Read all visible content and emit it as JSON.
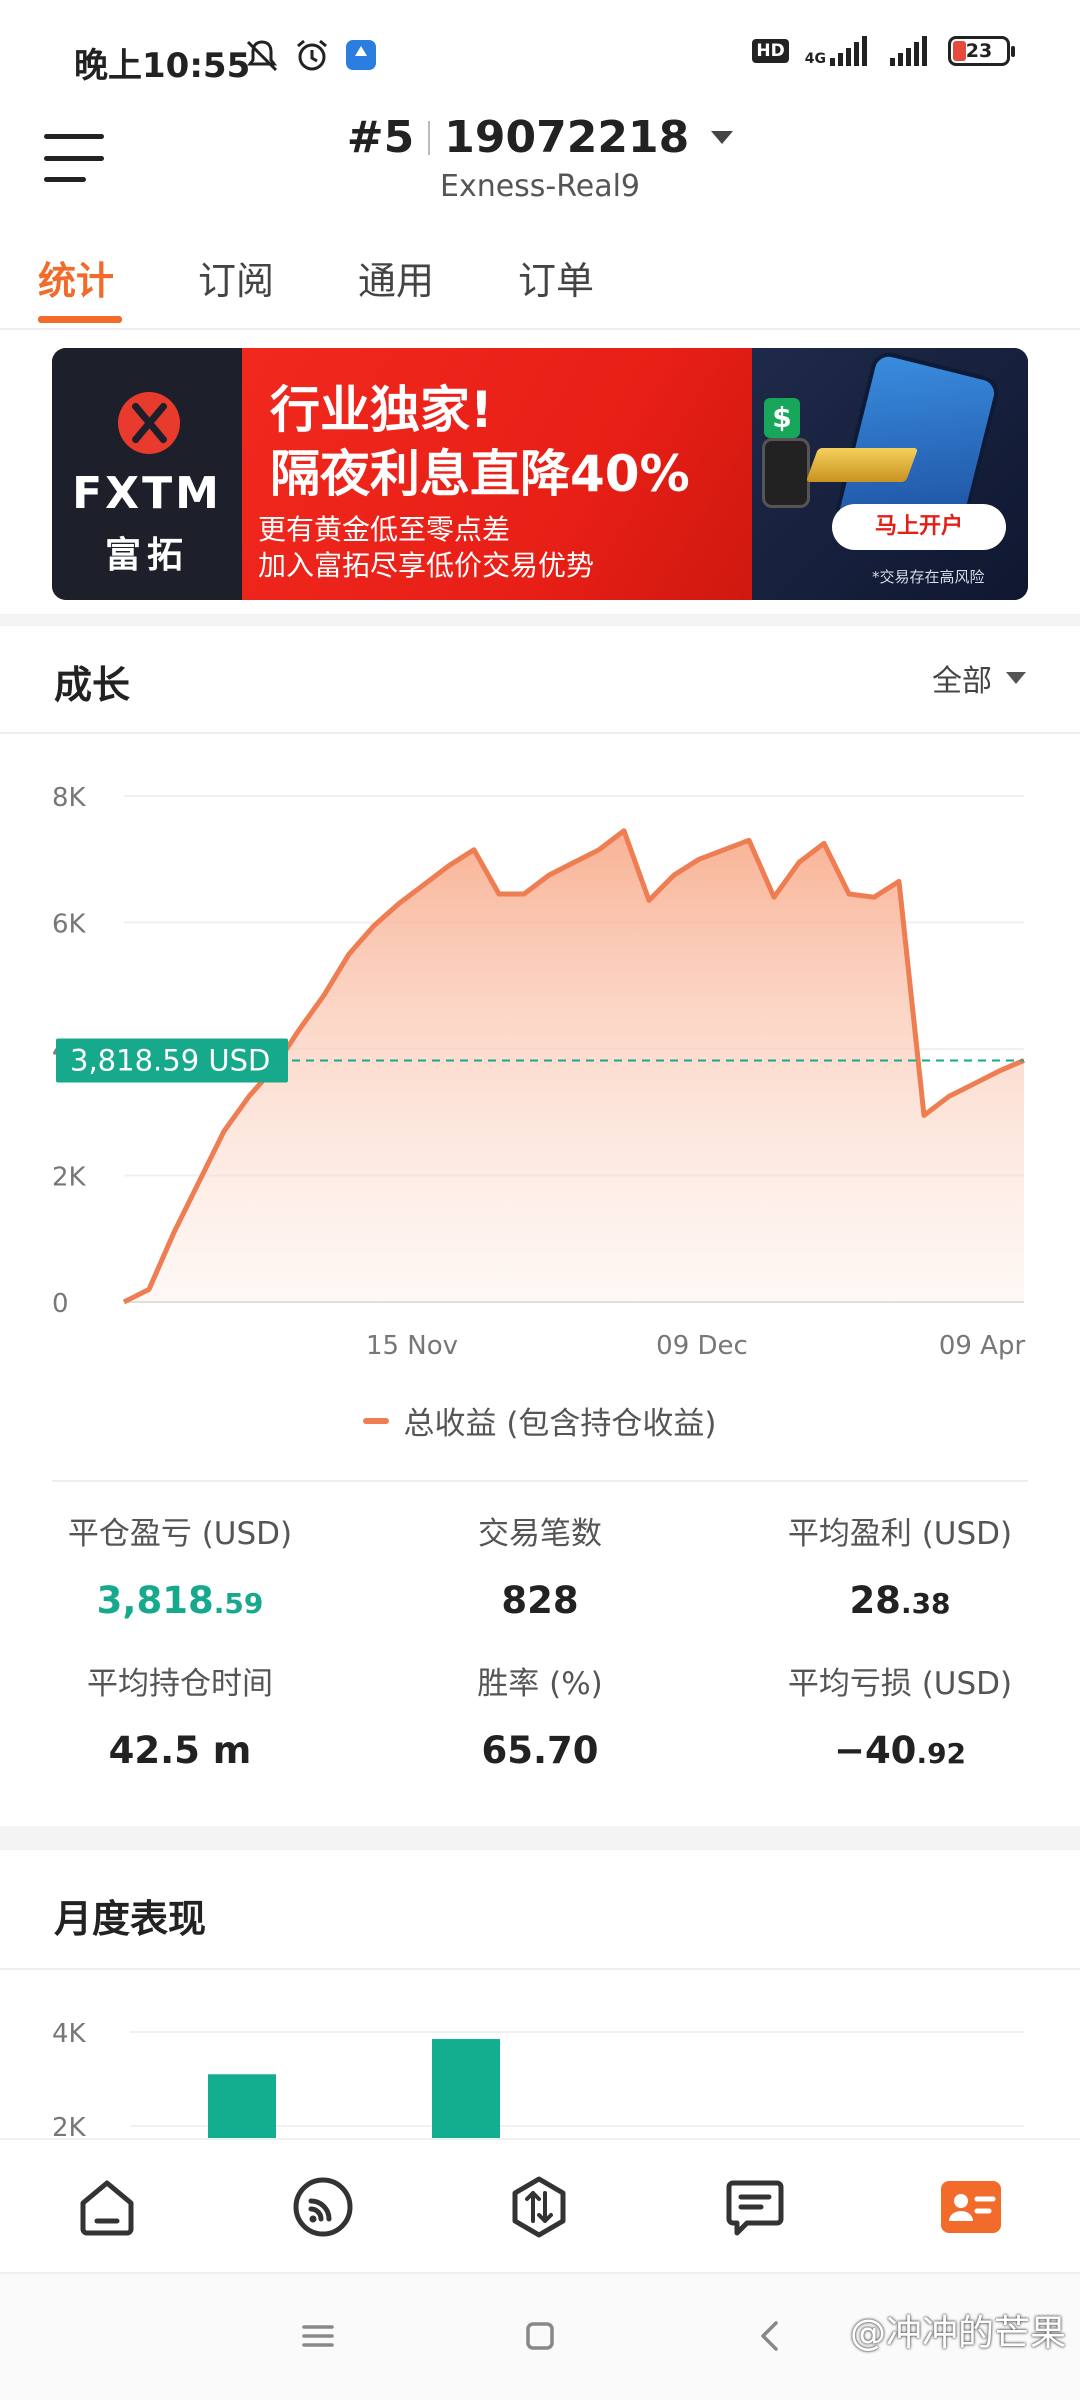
{
  "status_bar": {
    "time": "晚上10:55",
    "hd": "HD",
    "network": "4G",
    "battery": "23",
    "icons": [
      "mute-bell-icon",
      "alarm-icon",
      "app-notification-icon",
      "signal-icon",
      "wifi-signal-icon",
      "battery-icon"
    ]
  },
  "header": {
    "account_number_prefix": "#5",
    "account_id": "19072218",
    "server": "Exness-Real9"
  },
  "tabs": [
    {
      "label": "统计",
      "active": true
    },
    {
      "label": "订阅",
      "active": false
    },
    {
      "label": "通用",
      "active": false
    },
    {
      "label": "订单",
      "active": false
    }
  ],
  "banner": {
    "brand": "FXTM",
    "brand_cn": "富拓",
    "headline1": "行业独家!",
    "headline2": "隔夜利息直降40%",
    "sub1": "更有黄金低至零点差",
    "sub2": "加入富拓尽享低价交易优势",
    "cta": "马上开户",
    "risk_note": "*交易存在高风险",
    "icon_dollar": "$"
  },
  "growth": {
    "title": "成长",
    "range": "全部",
    "current_value_label": "3,818.59 USD",
    "legend": "总收益 (包含持仓收益)"
  },
  "chart_data": [
    {
      "type": "area",
      "series": [
        {
          "name": "总收益 (包含持仓收益)",
          "color": "#ee7d52",
          "values": [
            0,
            200,
            1100,
            1900,
            2700,
            3250,
            3700,
            4300,
            4850,
            5500,
            5950,
            6300,
            6600,
            6900,
            7150,
            6450,
            6450,
            6750,
            6950,
            7150,
            7450,
            6350,
            6750,
            7000,
            7150,
            7300,
            6400,
            6950,
            7250,
            6450,
            6400,
            6650,
            2950,
            3250,
            3450,
            3650,
            3819
          ]
        }
      ],
      "y_ticks": [
        "0",
        "2K",
        "4K",
        "6K",
        "8K"
      ],
      "x_ticks": [
        "15 Nov",
        "09 Dec",
        "09 Apr"
      ],
      "ylim": [
        0,
        8000
      ],
      "reference_value": 3818.59,
      "grid": true
    },
    {
      "type": "bar",
      "y_ticks": [
        "2K",
        "4K"
      ],
      "values": [
        3100,
        3850
      ],
      "color": "#13ad8f"
    }
  ],
  "stats": [
    {
      "label": "平仓盈亏 (USD)",
      "value_main": "3,818",
      "value_dec": ".59",
      "green": true
    },
    {
      "label": "交易笔数",
      "value_main": "828",
      "value_dec": "",
      "green": false
    },
    {
      "label": "平均盈利 (USD)",
      "value_main": "28",
      "value_dec": ".38",
      "green": false
    },
    {
      "label": "平均持仓时间",
      "value_main": "42.5 m",
      "value_dec": "",
      "green": false
    },
    {
      "label": "胜率 (%)",
      "value_main": "65.70",
      "value_dec": "",
      "green": false
    },
    {
      "label": "平均亏损 (USD)",
      "value_main": "−40",
      "value_dec": ".92",
      "green": false
    }
  ],
  "monthly": {
    "title": "月度表现"
  },
  "bottom_nav": [
    {
      "icon": "home-icon",
      "active": false
    },
    {
      "icon": "signal-feed-icon",
      "active": false
    },
    {
      "icon": "trade-icon",
      "active": false
    },
    {
      "icon": "chat-icon",
      "active": false
    },
    {
      "icon": "profile-card-icon",
      "active": true
    }
  ],
  "watermark": "@冲冲的芒果",
  "colors": {
    "accent": "#f26b2a",
    "green": "#16a98c",
    "line": "#ee7d52"
  }
}
